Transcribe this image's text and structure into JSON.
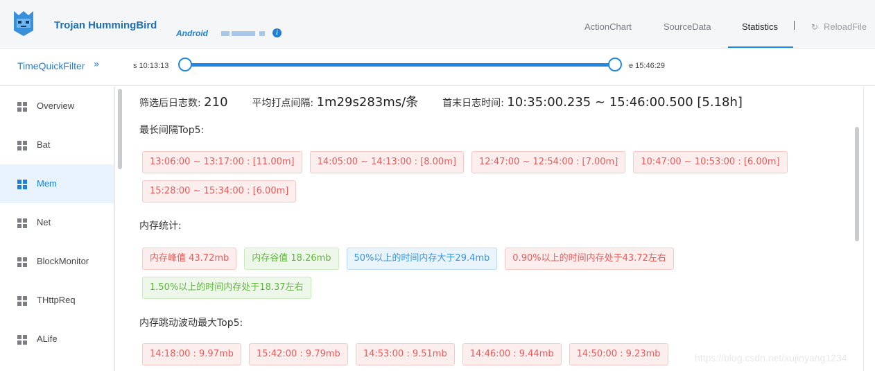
{
  "header": {
    "brand": "Trojan HummingBird",
    "platform": "Android",
    "nav": [
      "ActionChart",
      "SourceData",
      "Statistics"
    ],
    "active_tab": "Statistics",
    "reload_label": "ReloadFile"
  },
  "filter": {
    "label": "TimeQuickFilter",
    "chevron": "»",
    "start": "s 10:13:13",
    "end": "e 15:46:29",
    "range_start_fraction": 0,
    "range_end_fraction": 1
  },
  "sidebar": {
    "items": [
      "Overview",
      "Bat",
      "Mem",
      "Net",
      "BlockMonitor",
      "THttpReq",
      "ALife"
    ],
    "active": "Mem"
  },
  "main": {
    "stats": {
      "count_label": "筛选后日志数:",
      "count_value": "210",
      "interval_label": "平均打点间隔:",
      "interval_value": "1m29s283ms/条",
      "range_label": "首末日志时间:",
      "range_value": "10:35:00.235 ~ 15:46:00.500 [5.18h]"
    },
    "top_gap_title": "最长间隔Top5:",
    "top_gaps": [
      "13:06:00 ~ 13:17:00 : [11.00m]",
      "14:05:00 ~ 14:13:00 : [8.00m]",
      "12:47:00 ~ 12:54:00 : [7.00m]",
      "10:47:00 ~ 10:53:00 : [6.00m]",
      "15:28:00 ~ 15:34:00 : [6.00m]"
    ],
    "mem_title": "内存统计:",
    "mem_stats": [
      {
        "text": "内存峰值 43.72mb",
        "color": "red"
      },
      {
        "text": "内存谷值 18.26mb",
        "color": "green"
      },
      {
        "text": "50%以上的时间内存大于29.4mb",
        "color": "blue"
      },
      {
        "text": "0.90%以上的时间内存处于43.72左右",
        "color": "red"
      },
      {
        "text": "1.50%以上的时间内存处于18.37左右",
        "color": "green"
      }
    ],
    "jump_title": "内存跳动波动最大Top5:",
    "jumps": [
      "14:18:00 : 9.97mb",
      "15:42:00 : 9.79mb",
      "14:53:00 : 9.51mb",
      "14:46:00 : 9.44mb",
      "14:50:00 : 9.23mb"
    ]
  },
  "watermark": "https://blog.csdn.net/xujinyang1234"
}
